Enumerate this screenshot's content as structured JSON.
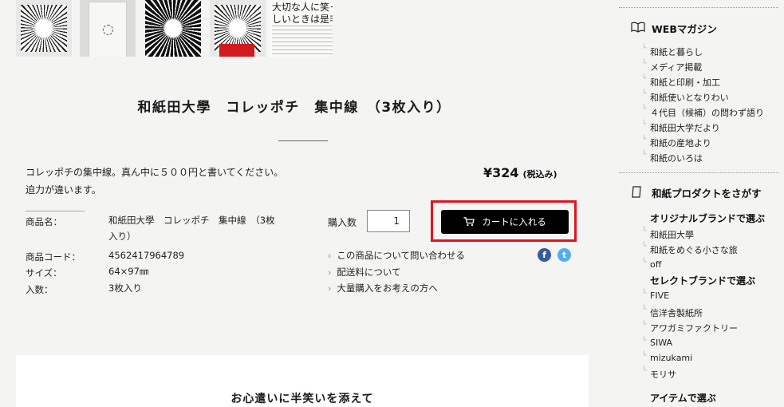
{
  "product": {
    "title": "和紙田大學　コレッポチ　集中線　（3枚入り）",
    "description": "コレッポチの集中線。真ん中に５００円と書いてください。迫力が違います。",
    "price": "¥324",
    "tax_note": "(税込み)",
    "thumb_text": [
      "大切な人に笑っ",
      "しいときは是非"
    ],
    "specs": [
      {
        "label": "商品名：",
        "value": "和紙田大學　コレッポチ　集中線　（3枚入り）"
      },
      {
        "label": "商品コード：",
        "value": "4562417964789"
      },
      {
        "label": "サイズ：",
        "value": "64×97㎜"
      },
      {
        "label": "入数：",
        "value": "3枚入り"
      }
    ]
  },
  "purchase": {
    "qty_label": "購入数",
    "qty_value": "1",
    "cart_button": "カートに入れる",
    "links": [
      "この商品について問い合わせる",
      "配送料について",
      "大量購入をお考えの方へ"
    ]
  },
  "social": {
    "facebook": "f",
    "twitter": "t",
    "facebook_color": "#3b5998",
    "twitter_color": "#55acee"
  },
  "section": {
    "heading": "お心遣いに半笑いを添えて"
  },
  "sidebar": {
    "web_magazine": {
      "title": "WEBマガジン",
      "items": [
        "和紙と暮らし",
        "メディア掲載",
        "和紙と印刷・加工",
        "和紙使いとなりわい",
        "４代目（候補）の問わず語り",
        "和紙田大学だより",
        "和紙の産地より",
        "和紙のいろは"
      ]
    },
    "product_search": {
      "title": "和紙プロダクトをさがす",
      "original_heading": "オリジナルブランドで選ぶ",
      "original_items": [
        "和紙田大學",
        "和紙をめぐる小さな旅",
        "off"
      ],
      "select_heading": "セレクトブランドで選ぶ",
      "select_items": [
        "FIVE",
        "信洋舎製紙所",
        "アワガミファクトリー",
        "SIWA",
        "mizukami",
        "モリサ"
      ],
      "item_heading": "アイテムで選ぶ"
    }
  },
  "colors": {
    "cart_button_bg": "#000000",
    "cart_highlight_border": "#e0141e"
  }
}
